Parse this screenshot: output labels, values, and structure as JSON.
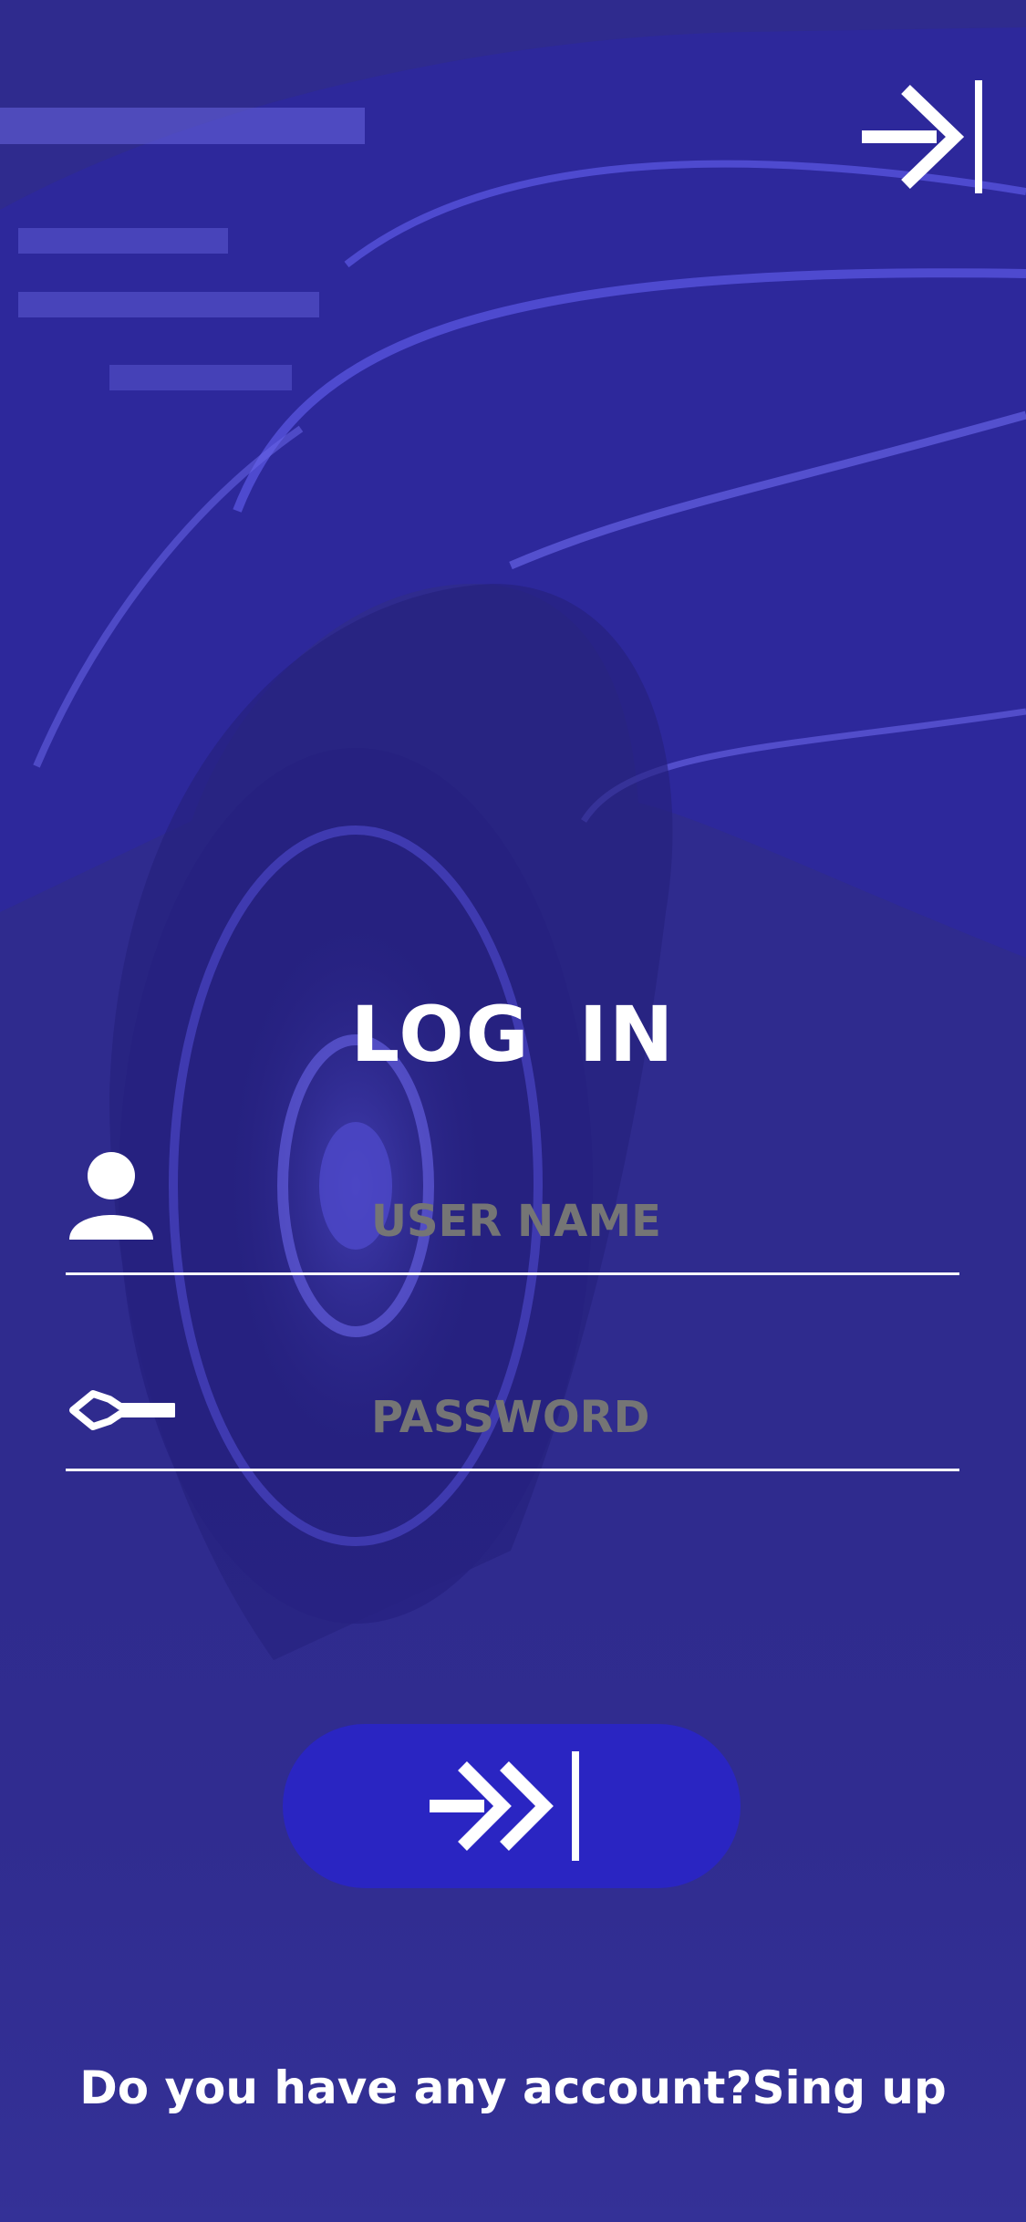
{
  "login": {
    "title": "LOG  IN",
    "username_placeholder": "USER NAME",
    "password_placeholder": "PASSWORD"
  },
  "footer": {
    "question": "Do you have any account?",
    "signup_label": "Sing up"
  },
  "icons": {
    "top_skip": "arrow-right-to-bar-icon",
    "user": "user-icon",
    "password": "key-icon",
    "submit": "double-chevron-bar-icon"
  },
  "colors": {
    "background": "#2f2b8e",
    "button": "#2a25c2",
    "text": "#ffffff"
  }
}
